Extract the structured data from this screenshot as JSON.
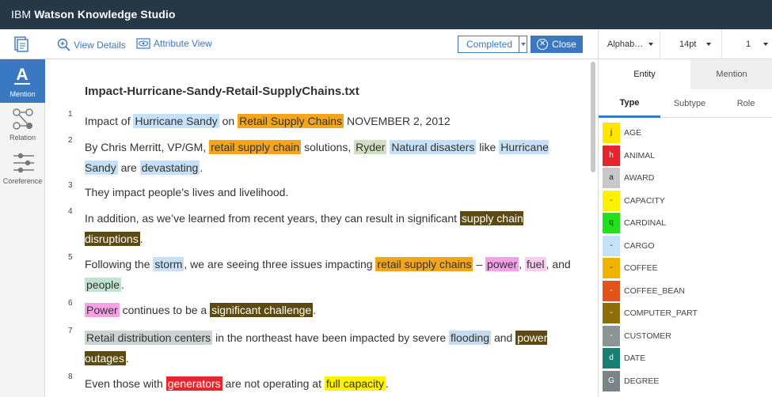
{
  "app": {
    "ibm": "IBM",
    "product": "Watson Knowledge Studio"
  },
  "toolbar": {
    "view_details": "View Details",
    "attribute_view": "Attribute View",
    "status": "Completed",
    "close": "Close"
  },
  "right_toolbar": {
    "sort": "Alphab…",
    "font_size": "14pt",
    "page": "1"
  },
  "nav": {
    "mention": "Mention",
    "relation": "Relation",
    "coreference": "Coreference"
  },
  "document": {
    "title": "Impact-Hurricane-Sandy-Retail-SupplyChains.txt",
    "paragraphs": [
      {
        "num": "1",
        "segments": [
          {
            "t": "Impact of "
          },
          {
            "t": "Hurricane Sandy",
            "c": "#c6e1f7"
          },
          {
            "t": " on "
          },
          {
            "t": "Retail Supply Chains",
            "c": "#f5a51d"
          },
          {
            "t": " NOVEMBER 2, 2012"
          }
        ]
      },
      {
        "num": "2",
        "segments": [
          {
            "t": "By Chris Merritt, VP/GM, "
          },
          {
            "t": "retail supply chain",
            "c": "#f5a51d"
          },
          {
            "t": " solutions, "
          },
          {
            "t": "Ryder",
            "c": "#d2dfc3"
          },
          {
            "t": " "
          },
          {
            "t": "Natural disasters",
            "c": "#c6e1f7"
          },
          {
            "t": " like "
          },
          {
            "t": "Hurricane Sandy",
            "c": "#c6e1f7"
          },
          {
            "t": " are "
          },
          {
            "t": "devastating",
            "c": "#c6e1f7"
          },
          {
            "t": "."
          }
        ]
      },
      {
        "num": "3",
        "segments": [
          {
            "t": "They impact people’s lives and livelihood."
          }
        ]
      },
      {
        "num": "4",
        "segments": [
          {
            "t": "In addition, as we’ve learned from recent years, they can result in significant "
          },
          {
            "t": "supply chain disruptions",
            "c": "#5c4a12",
            "fg": "#ffffff"
          },
          {
            "t": "."
          }
        ]
      },
      {
        "num": "5",
        "segments": [
          {
            "t": "Following the "
          },
          {
            "t": "storm",
            "c": "#c6e1f7"
          },
          {
            "t": ", we are seeing three issues impacting "
          },
          {
            "t": "retail supply chains",
            "c": "#f5a51d"
          },
          {
            "t": " – "
          },
          {
            "t": "power",
            "c": "#f6a0e8"
          },
          {
            "t": ", "
          },
          {
            "t": "fuel",
            "c": "#f9cdf0"
          },
          {
            "t": ", and "
          },
          {
            "t": "people",
            "c": "#c1e3d2"
          },
          {
            "t": "."
          }
        ]
      },
      {
        "num": "6",
        "segments": [
          {
            "t": "Power",
            "c": "#f6a0e8"
          },
          {
            "t": " continues to be a "
          },
          {
            "t": "significant challenge",
            "c": "#5c4a12",
            "fg": "#ffffff"
          },
          {
            "t": "."
          }
        ]
      },
      {
        "num": "7",
        "segments": [
          {
            "t": "Retail distribution centers",
            "c": "#cbd3d4"
          },
          {
            "t": " in the northeast have been impacted by severe "
          },
          {
            "t": "flooding",
            "c": "#c6daf0"
          },
          {
            "t": " and "
          },
          {
            "t": "power outages",
            "c": "#5c4a12",
            "fg": "#ffffff"
          },
          {
            "t": "."
          }
        ]
      },
      {
        "num": "8",
        "segments": [
          {
            "t": "Even those with "
          },
          {
            "t": "generators",
            "c": "#e5262e",
            "fg": "#ffffff"
          },
          {
            "t": " are not operating at "
          },
          {
            "t": "full capacity",
            "c": "#fff200"
          },
          {
            "t": "."
          }
        ]
      }
    ]
  },
  "right_panel": {
    "tabs": [
      "Entity",
      "Mention"
    ],
    "subtabs": [
      "Type",
      "Subtype",
      "Role"
    ],
    "types": [
      {
        "key": "j",
        "name": "AGE",
        "color": "#ffe600",
        "fg": "#222"
      },
      {
        "key": "h",
        "name": "ANIMAL",
        "color": "#e5262e",
        "fg": "#fff"
      },
      {
        "key": "a",
        "name": "AWARD",
        "color": "#c8c8c8",
        "fg": "#222"
      },
      {
        "key": "-",
        "name": "CAPACITY",
        "color": "#fff200",
        "fg": "#222"
      },
      {
        "key": "q",
        "name": "CARDINAL",
        "color": "#22e01c",
        "fg": "#222"
      },
      {
        "key": "-",
        "name": "CARGO",
        "color": "#c6e1f7",
        "fg": "#222"
      },
      {
        "key": "-",
        "name": "COFFEE",
        "color": "#f0b400",
        "fg": "#222"
      },
      {
        "key": "-",
        "name": "COFFEE_BEAN",
        "color": "#e0531a",
        "fg": "#fff"
      },
      {
        "key": "-",
        "name": "COMPUTER_PART",
        "color": "#8e6d0a",
        "fg": "#fff"
      },
      {
        "key": "-",
        "name": "CUSTOMER",
        "color": "#8d9496",
        "fg": "#fff"
      },
      {
        "key": "d",
        "name": "DATE",
        "color": "#1a7f73",
        "fg": "#fff"
      },
      {
        "key": "G",
        "name": "DEGREE",
        "color": "#7a8385",
        "fg": "#fff"
      }
    ]
  }
}
